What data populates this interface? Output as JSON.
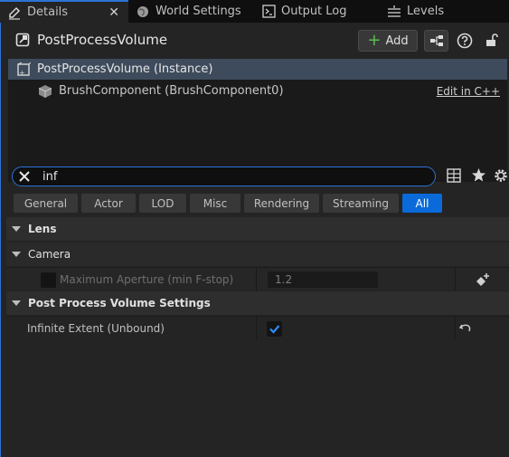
{
  "tabs": [
    {
      "label": "Details",
      "icon": "pencil-icon"
    },
    {
      "label": "World Settings",
      "icon": "globe-icon"
    },
    {
      "label": "Output Log",
      "icon": "terminal-icon"
    },
    {
      "label": "Levels",
      "icon": "stack-icon"
    }
  ],
  "header": {
    "title": "PostProcessVolume",
    "add_label": "Add"
  },
  "tree": {
    "root": "PostProcessVolume (Instance)",
    "child": "BrushComponent (BrushComponent0)",
    "edit_link": "Edit in C++"
  },
  "search": {
    "value": "inf"
  },
  "filters": [
    "General",
    "Actor",
    "LOD",
    "Misc",
    "Rendering",
    "Streaming",
    "All"
  ],
  "filter_active": "All",
  "properties": {
    "lens": "Lens",
    "camera": "Camera",
    "max_aperture_label": "Maximum Aperture (min F-stop)",
    "max_aperture_value": "1.2",
    "ppv_settings": "Post Process Volume Settings",
    "infinite_extent_label": "Infinite Extent (Unbound)"
  },
  "colors": {
    "accent": "#2b72d6",
    "filter_active": "#0a6ad9",
    "add_plus": "#55c24a"
  }
}
